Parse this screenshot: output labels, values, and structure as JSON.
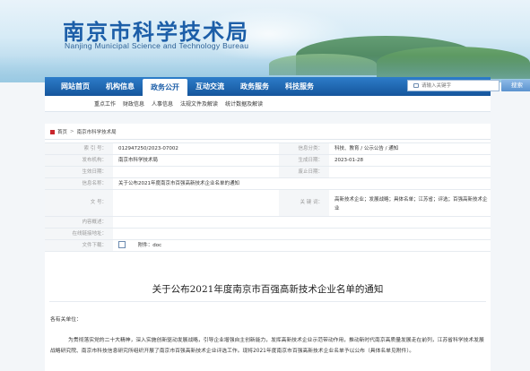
{
  "header": {
    "title": "南京市科学技术局",
    "subtitle": "Nanjing Municipal Science and Technology Bureau"
  },
  "nav": {
    "items": [
      {
        "label": "网站首页",
        "active": false
      },
      {
        "label": "机构信息",
        "active": false
      },
      {
        "label": "政务公开",
        "active": true
      },
      {
        "label": "互动交流",
        "active": false
      },
      {
        "label": "政务服务",
        "active": false
      },
      {
        "label": "科技服务",
        "active": false
      }
    ],
    "search_placeholder": "请输入关键字",
    "search_button": "搜索"
  },
  "subnav": {
    "items": [
      "重点工作",
      "财政信息",
      "人事信息",
      "法规文件及解读",
      "统计数据及解读"
    ]
  },
  "breadcrumb": {
    "home": "首页",
    "separator": ">",
    "current": "南京市科学技术局"
  },
  "info": {
    "index_label": "索 引 号：",
    "index_value": "012947250/2023-07002",
    "category_label": "信息分类：",
    "category_value": "科技、教育 / 公示公告 / 通知",
    "issuer_label": "发布机构：",
    "issuer_value": "南京市科学技术局",
    "date_label": "生成日期：",
    "date_value": "2023-01-28",
    "effective_label": "生效日期：",
    "effective_value": "",
    "expire_label": "废止日期：",
    "expire_value": "",
    "name_label": "信息名称：",
    "name_value": "关于公布2021年度南京市百强高新技术企业名单的通知",
    "docno_label": "文 号：",
    "docno_value": "",
    "keywords_label": "关 键 词：",
    "keywords_value": "高新技术企业；发展战略；具体名单；江苏省；评选；百强高新技术企业",
    "content_label": "内容概述：",
    "content_value": "",
    "online_label": "在线链接地址：",
    "online_value": "",
    "download_label": "文件下载：",
    "download_value": "附件：doc"
  },
  "document": {
    "title": "关于公布2021年度南京市百强高新技术企业名单的通知",
    "salutation": "各有关单位：",
    "paragraph": "为贯彻落实党的二十大精神，深入实施创新驱动发展战略，引导企业增强自主创新能力，发挥高新技术企业示范带动作用，推动新时代南京高质量发展走在前列，江苏省科学技术发展战略研究院、南京市科技信息研究所组织开展了南京市百强高新技术企业评选工作。现将2021年度南京市百强高新技术企业名单予以公布（具体名单见附件）。"
  }
}
